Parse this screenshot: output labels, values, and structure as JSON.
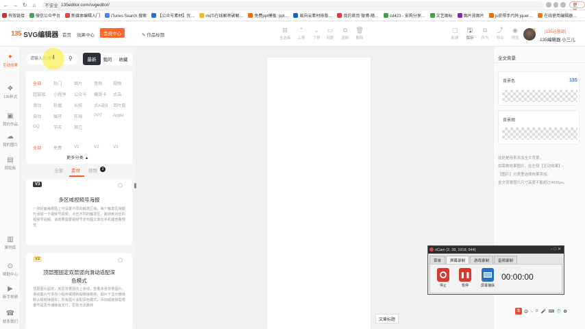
{
  "browser": {
    "security_label": "不安全",
    "url": "135editor.com/svgeditor/",
    "update_label": "更新"
  },
  "bookmarks": [
    {
      "label": "有效链接",
      "color": "#d93025"
    },
    {
      "label": "微信公众平台",
      "color": "#34a853"
    },
    {
      "label": "新媒体编辑入门",
      "color": "#ea4335"
    },
    {
      "label": "iTunes Search 搜索",
      "color": "#4285f4"
    },
    {
      "label": "【公众号素材】优…",
      "color": "#1a73e8"
    },
    {
      "label": "mdTi在线解密破解…",
      "color": "#fbbc05"
    },
    {
      "label": "免费ppt模板: ppt…",
      "color": "#ff6d00"
    },
    {
      "label": "易向云素材排版…",
      "color": "#1565c0"
    },
    {
      "label": "我的首页 微博-随…",
      "color": "#e53935"
    },
    {
      "label": "cd423 - 安购分享…",
      "color": "#43a047"
    },
    {
      "label": "文艺图标",
      "color": "#43a047"
    },
    {
      "label": "图片放图片",
      "color": "#8e24aa"
    },
    {
      "label": "js获得手代码 jquer…",
      "color": "#ef6c00"
    },
    {
      "label": "在线使用编辑器…",
      "color": "#f57c00"
    }
  ],
  "header": {
    "logo_mark": "135",
    "logo_text": "SVG编辑器",
    "nav_home": "首页",
    "nav_effects": "效果中心",
    "vip_button": "会员中心",
    "work_title": "作品标题",
    "toolbar": [
      {
        "label": "全选画",
        "icon": "select-all-icon"
      },
      {
        "label": "上移",
        "icon": "move-up-icon"
      },
      {
        "label": "下移",
        "icon": "move-down-icon"
      },
      {
        "label": "间距",
        "icon": "spacing-icon"
      },
      {
        "label": "复制",
        "icon": "copy-icon"
      },
      {
        "label": "删除",
        "icon": "delete-icon"
      }
    ],
    "actions": [
      {
        "label": "新建",
        "icon": "new-icon"
      },
      {
        "label": "保存",
        "icon": "save-icon"
      },
      {
        "label": "存为",
        "icon": "save-as-icon"
      },
      {
        "label": "导出",
        "icon": "export-icon"
      },
      {
        "label": "预览",
        "icon": "preview-icon"
      }
    ],
    "vip_label": "[135运营部]",
    "user_name": "135编辑器 小三儿"
  },
  "rail": [
    {
      "label": "互动效果",
      "active": true
    },
    {
      "label": "135样式"
    },
    {
      "label": "我的作品"
    },
    {
      "label": "我的图片"
    },
    {
      "label": "剪贴板"
    },
    {
      "label": "案例库"
    },
    {
      "label": "帮助中心"
    },
    {
      "label": "新手视频"
    },
    {
      "label": "联系我们"
    }
  ],
  "panel": {
    "search_placeholder": "请输入关键词",
    "seg_latest": "最新",
    "seg_mine": "我的",
    "seg_fav": "收藏",
    "categories_row1": [
      "全部",
      "热门",
      "图片",
      "音频",
      "视频"
    ],
    "categories_row2": [
      "超链接",
      "小程序",
      "公众号",
      "横滑卡",
      "点击"
    ],
    "categories_row3": [
      "滑动",
      "轮播",
      "长按",
      "点A返B",
      "百叶窗"
    ],
    "categories_row4": [
      "自动",
      "展开",
      "布局",
      "PPT",
      "Apple"
    ],
    "categories_row5": [
      "GQ",
      "节庆",
      "其它"
    ],
    "versions": [
      "全部",
      "免费",
      "V1",
      "V2",
      "V3"
    ],
    "more_label": "更多分类 ▲",
    "subtab_all": "全部",
    "subtab_material": "素材",
    "subtab_video": "视频",
    "badge_count": "3"
  },
  "cards": [
    {
      "tag": "V3",
      "title": "多区域视频号海报",
      "desc": "一张封面海报图上可设置不同的触发区域，每个触发区域都可添加一个视频号视频，点击不同的触发区，跳转到对应的视频号视频。该效果需要视频号发布图文章在手机端查看预览"
    },
    {
      "tag": "V2",
      "title": "顶层图固定双层竖向滑动适配深色模式",
      "desc": "顶层图片固定，底层背景图向上滑动，查看多张背景图片。滑动图片可添加小程序或跳转超链接跳转，图片下显示微信默认超链接图标；所有图片适配深色模式，添加超链接需根据号是否开通微信支付，否则无法跳转"
    }
  ],
  "canvas": {
    "article_title_button": "文章标题"
  },
  "right_panel": {
    "title": "全文背景",
    "bg_color_label": "背景色",
    "bg_image_label": "背景图",
    "logo": "135",
    "notes": [
      "此处是用来添加全文背景，",
      "如需做效果图片，在左侧【互动效果】-",
      "【图片】分类里选择效果添加。",
      "全文背景图片尺寸高度不能超过4000px。"
    ]
  },
  "ocam": {
    "title": "oCam (2, 38, 1918, 944)",
    "tabs": [
      "菜单",
      "屏幕录制",
      "游戏录制",
      "音频录制"
    ],
    "stop_label": "停止",
    "pause_label": "暂停",
    "capture_label": "屏幕捕获",
    "timer": "00:00:00"
  },
  "ime": {
    "logo": "S",
    "items": [
      "中",
      "·,",
      "☺",
      "🎤",
      "⌨",
      "👕",
      "✿"
    ]
  }
}
